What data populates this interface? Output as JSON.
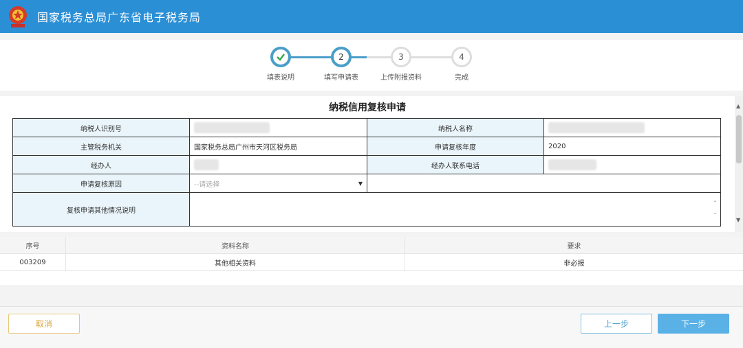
{
  "header": {
    "title": "国家税务总局广东省电子税务局"
  },
  "steps": [
    {
      "label": "填表说明",
      "number": "",
      "state": "done"
    },
    {
      "label": "填写申请表",
      "number": "2",
      "state": "active"
    },
    {
      "label": "上传附报资料",
      "number": "3",
      "state": "todo"
    },
    {
      "label": "完成",
      "number": "4",
      "state": "todo"
    }
  ],
  "form": {
    "title": "纳税信用复核申请",
    "taxpayer_id_label": "纳税人识别号",
    "taxpayer_name_label": "纳税人名称",
    "tax_office_label": "主管税务机关",
    "tax_office_value": "国家税务总局广州市天河区税务局",
    "review_year_label": "申请复核年度",
    "review_year_value": "2020",
    "handler_label": "经办人",
    "handler_phone_label": "经办人联系电话",
    "reason_label": "申请复核原因",
    "reason_placeholder": "--请选择",
    "other_label": "复核申请其他情况说明"
  },
  "docs_table": {
    "headers": [
      "序号",
      "资料名称",
      "要求"
    ],
    "rows": [
      {
        "no": "003209",
        "name": "其他相关资料",
        "requirement": "非必报"
      }
    ]
  },
  "buttons": {
    "cancel": "取消",
    "prev": "上一步",
    "next": "下一步"
  }
}
